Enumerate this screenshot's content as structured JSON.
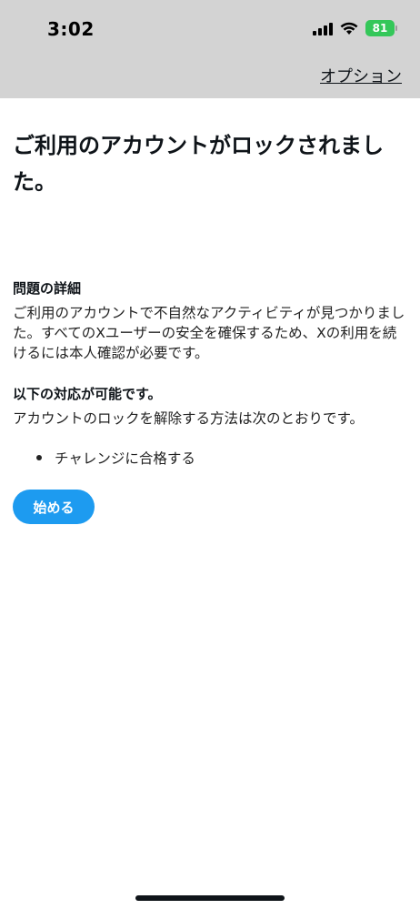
{
  "status_bar": {
    "time": "3:02",
    "battery": "81"
  },
  "nav": {
    "options_label": "オプション"
  },
  "main": {
    "title": "ご利用のアカウントがロックされました。"
  },
  "details": {
    "heading": "問題の詳細",
    "body": "ご利用のアカウントで不自然なアクティビティが見つかりました。すべてのXユーザーの安全を確保するため、Xの利用を続けるには本人確認が必要です。"
  },
  "available": {
    "heading": "以下の対応が可能です。",
    "body": "アカウントのロックを解除する方法は次のとおりです。",
    "items": [
      "チャレンジに合格する"
    ]
  },
  "actions": {
    "start_label": "始める"
  },
  "colors": {
    "accent": "#1d9bf0",
    "top_bar": "#d3d3d3",
    "battery": "#34c759"
  }
}
